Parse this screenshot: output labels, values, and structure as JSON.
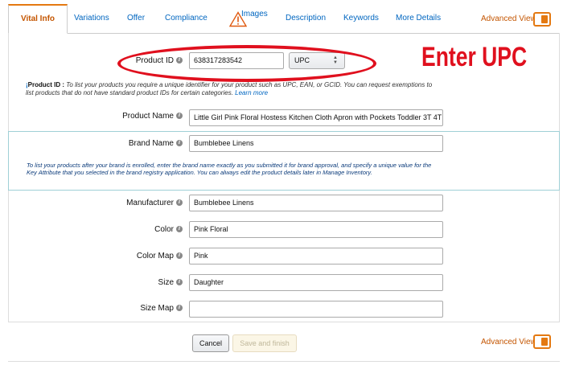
{
  "tabs": [
    {
      "label": "Vital Info",
      "active": true
    },
    {
      "label": "Variations"
    },
    {
      "label": "Offer"
    },
    {
      "label": "Compliance"
    },
    {
      "label": "Images",
      "icon": "warning-icon"
    },
    {
      "label": "Description"
    },
    {
      "label": "Keywords"
    },
    {
      "label": "More Details"
    }
  ],
  "advanced_view": {
    "label": "Advanced View",
    "on": true
  },
  "product_id": {
    "label": "Product ID",
    "value": "638317283542",
    "type_value": "UPC",
    "help_title": "Product ID :",
    "help_text": " To list your products you require a unique identifier for your product such as UPC, EAN, or GCID. You can request exemptions to list products that do not have standard product IDs for certain categories.",
    "learn_more": "Learn more"
  },
  "annotation": {
    "text": "Enter UPC",
    "color": "#e0101e"
  },
  "product_name": {
    "label": "Product Name",
    "value": "Little Girl Pink Floral Hostess Kitchen Cloth Apron with Pockets Toddler 3T 4T"
  },
  "brand_name": {
    "label": "Brand Name",
    "value": "Bumblebee Linens",
    "help_text": "To list your products after your brand is enrolled, enter the brand name exactly as you submitted it for brand approval, and specify a unique value for the Key Attribute that you selected in the brand registry application. You can always edit the product details later in Manage Inventory."
  },
  "fields": [
    {
      "label": "Manufacturer",
      "value": "Bumblebee Linens"
    },
    {
      "label": "Color",
      "value": "Pink Floral"
    },
    {
      "label": "Color Map",
      "value": "Pink"
    },
    {
      "label": "Size",
      "value": "Daughter"
    },
    {
      "label": "Size Map",
      "value": ""
    }
  ],
  "buttons": {
    "cancel": "Cancel",
    "save": "Save and finish"
  },
  "colors": {
    "accent": "#e47911",
    "link": "#0066c0",
    "active_tab": "#c45500"
  }
}
